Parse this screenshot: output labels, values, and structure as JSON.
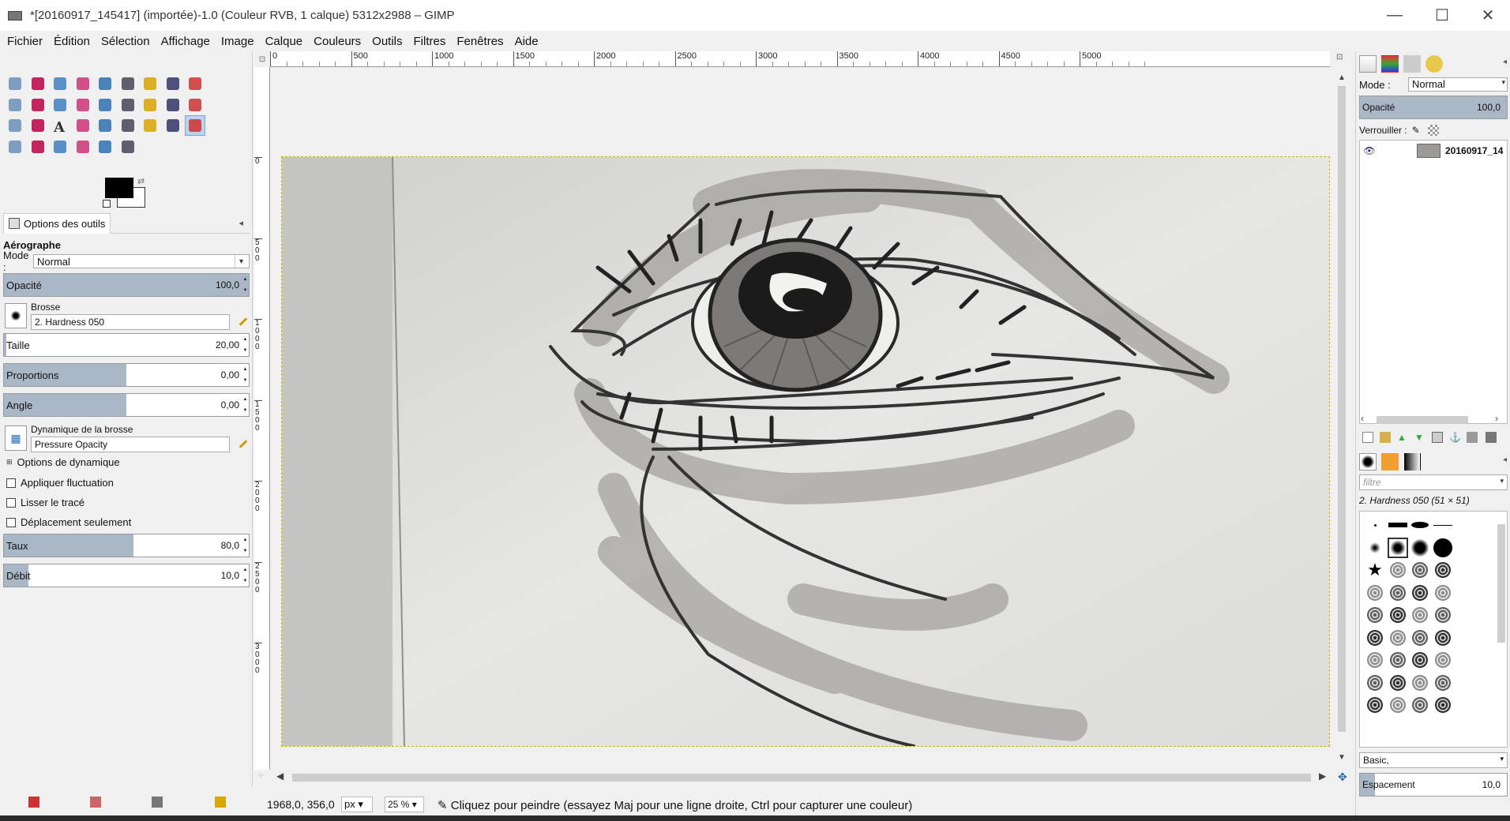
{
  "window": {
    "title": "*[20160917_145417] (importée)-1.0 (Couleur RVB, 1 calque) 5312x2988 – GIMP",
    "controls": {
      "minimize": "—",
      "maximize": "☐",
      "close": "✕"
    }
  },
  "menu": [
    "Fichier",
    "Édition",
    "Sélection",
    "Affichage",
    "Image",
    "Calque",
    "Couleurs",
    "Outils",
    "Filtres",
    "Fenêtres",
    "Aide"
  ],
  "tool_options": {
    "tab_label": "Options des outils",
    "tool_name": "Aérographe",
    "mode_label": "Mode :",
    "mode_value": "Normal",
    "opacity": {
      "label": "Opacité",
      "value": "100,0",
      "fraction": 1.0
    },
    "brush": {
      "label": "Brosse",
      "value": "2. Hardness 050"
    },
    "size": {
      "label": "Taille",
      "value": "20,00",
      "fraction": 0.01
    },
    "proportions": {
      "label": "Proportions",
      "value": "0,00",
      "fraction": 0.5
    },
    "angle": {
      "label": "Angle",
      "value": "0,00",
      "fraction": 0.5
    },
    "dynamics": {
      "label": "Dynamique de la brosse",
      "value": "Pressure Opacity"
    },
    "dynamics_options": "Options de dynamique",
    "checkboxes": [
      "Appliquer fluctuation",
      "Lisser le tracé",
      "Déplacement seulement"
    ],
    "rate": {
      "label": "Taux",
      "value": "80,0",
      "fraction": 0.53
    },
    "flow": {
      "label": "Débit",
      "value": "10,0",
      "fraction": 0.1
    }
  },
  "tools": [
    "rect-select",
    "ellipse-select",
    "free-select",
    "fuzzy-select",
    "color-select",
    "scissors",
    "foreground-select",
    "paths",
    "color-picker",
    "zoom",
    "measure",
    "move",
    "align",
    "crop",
    "rotate",
    "scale",
    "shear",
    "perspective",
    "flip",
    "cage",
    "text",
    "heal",
    "blend",
    "pencil",
    "paintbrush",
    "eraser",
    "airbrush",
    "ink",
    "clone",
    "perspective-clone",
    "convolve",
    "smudge",
    "dodge-burn"
  ],
  "ruler": {
    "h_labels": [
      "0",
      "500",
      "1000",
      "1500",
      "2000",
      "2500",
      "3000",
      "3500",
      "4000",
      "4500",
      "5000"
    ],
    "v_labels": [
      "0",
      "500",
      "1000",
      "1500",
      "2000",
      "2500",
      "3000"
    ]
  },
  "status": {
    "coords": "1968,0, 356,0",
    "unit": "px",
    "zoom": "25 %",
    "message": "Cliquez pour peindre (essayez Maj pour une ligne droite, Ctrl pour capturer une couleur)"
  },
  "layers": {
    "mode_label": "Mode :",
    "mode_value": "Normal",
    "opacity": {
      "label": "Opacité",
      "value": "100,0",
      "fraction": 1.0
    },
    "lock_label": "Verrouiller :",
    "items": [
      {
        "name": "20160917_14",
        "visible": true
      }
    ]
  },
  "brushes": {
    "filter_placeholder": "filtre",
    "selected_name": "2. Hardness 050 (51 × 51)",
    "set": "Basic,",
    "spacing": {
      "label": "Espacement",
      "value": "10,0",
      "fraction": 0.1
    }
  },
  "colors": {
    "accent": "#a9b7c6",
    "selection_dash": "#c8b400",
    "foreground": "#000000",
    "background": "#ffffff"
  }
}
